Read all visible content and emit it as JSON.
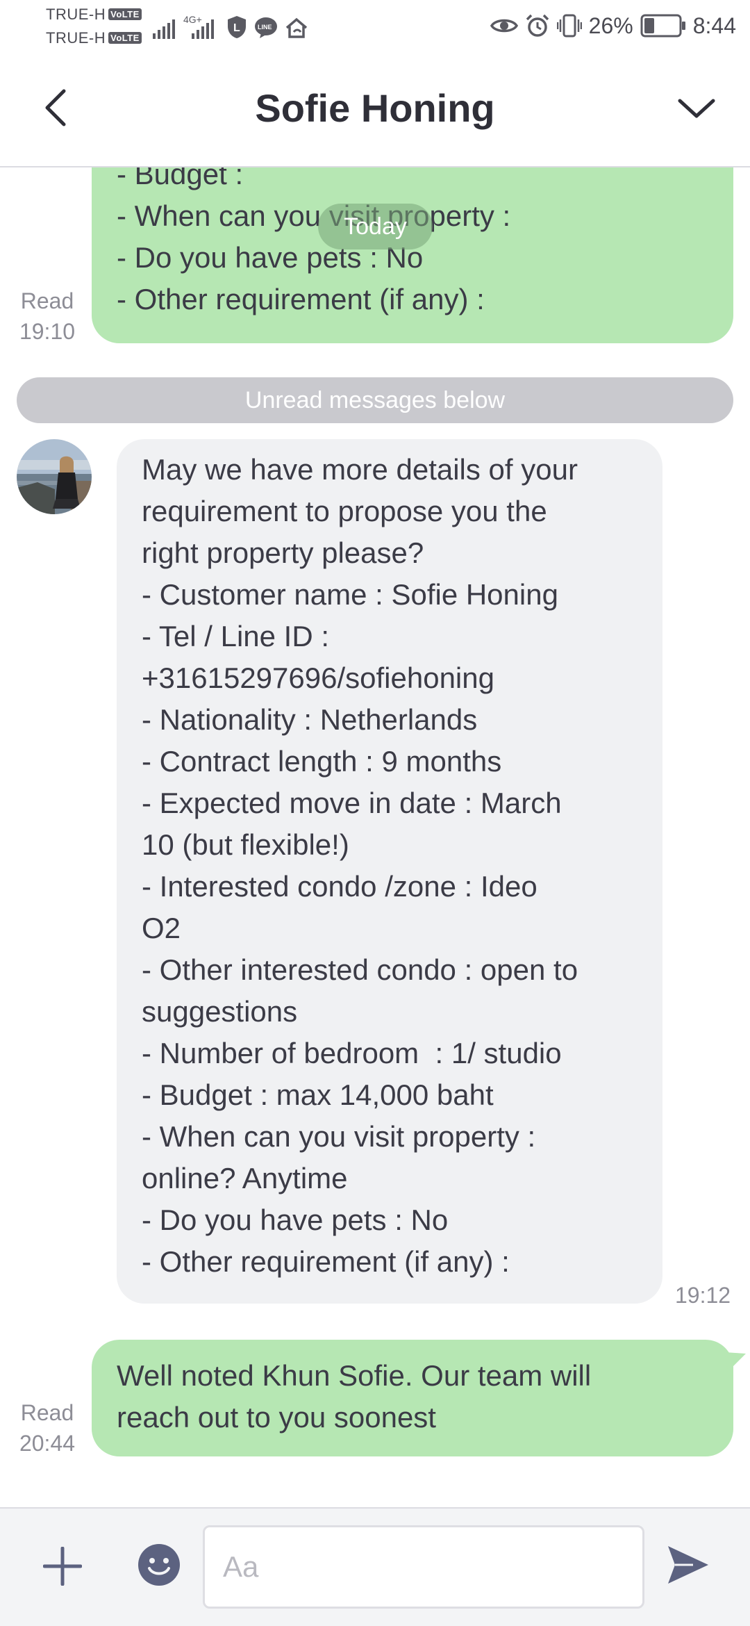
{
  "status_bar": {
    "carrier_1": "TRUE-H",
    "carrier_2": "TRUE-H",
    "volte": "VoLTE",
    "network": "4G+",
    "battery": "26%",
    "time": "8:44"
  },
  "header": {
    "title": "Sofie Honing",
    "back_icon": "chevron-left-icon",
    "expand_icon": "chevron-down-icon"
  },
  "chat": {
    "date_pill": "Today",
    "unread_divider": "Unread messages below",
    "messages": [
      {
        "direction": "outgoing",
        "lines": [
          "- Budget :",
          "- When can you visit property :",
          "- Do you have pets : No",
          "- Other requirement (if any) :"
        ],
        "read_label": "Read",
        "time": "19:10"
      },
      {
        "direction": "incoming",
        "lines": [
          "May we have more details of your",
          "requirement to propose you the",
          "right property please?",
          "- Customer name : Sofie Honing",
          "- Tel / Line ID :",
          "+31615297696/sofiehoning",
          "- Nationality : Netherlands",
          "- Contract length : 9 months",
          "- Expected move in date : March",
          "10 (but flexible!)",
          "- Interested condo /zone : Ideo",
          "O2",
          "- Other interested condo : open to",
          "suggestions",
          "- Number of bedroom  : 1/ studio",
          "- Budget : max 14,000 baht",
          "- When can you visit property :",
          "online? Anytime",
          "- Do you have pets : No",
          "- Other requirement (if any) :"
        ],
        "time": "19:12"
      },
      {
        "direction": "outgoing",
        "lines": [
          "Well noted Khun Sofie. Our team will",
          "reach out to you soonest"
        ],
        "read_label": "Read",
        "time": "20:44"
      }
    ]
  },
  "composer": {
    "placeholder": "Aa",
    "plus_icon": "plus-icon",
    "emoji_icon": "emoji-icon",
    "send_icon": "send-icon"
  },
  "colors": {
    "outgoing_bubble": "#b6e7b3",
    "incoming_bubble": "#f0f1f3",
    "text": "#3b3b46",
    "muted": "#8d8d96",
    "icon": "#5c6280"
  }
}
